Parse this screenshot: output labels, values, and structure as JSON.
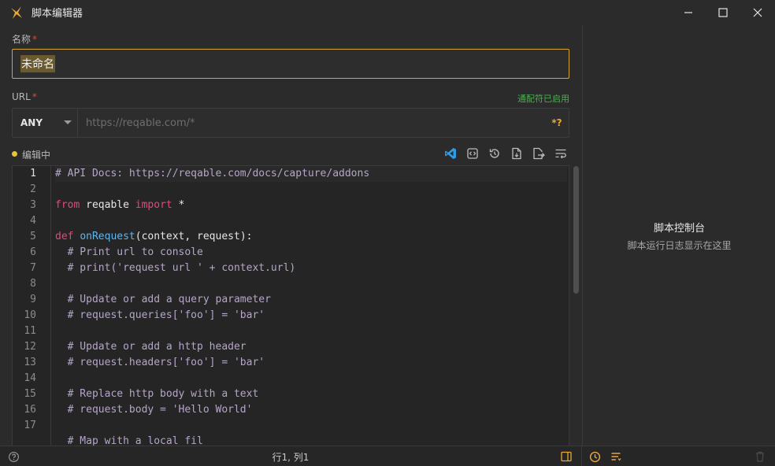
{
  "window": {
    "title": "脚本编辑器"
  },
  "form": {
    "name_label": "名称",
    "name_required": "*",
    "name_value": "未命名",
    "url_label": "URL",
    "url_required": "*",
    "wildcard_status": "通配符已启用",
    "method": "ANY",
    "url_placeholder": "https://reqable.com/*",
    "wildcard_button": "*?"
  },
  "editor": {
    "status": "编辑中",
    "status_color": "#e8c534",
    "line_numbers": [
      "1",
      "2",
      "3",
      "4",
      "5",
      "6",
      "7",
      "8",
      "9",
      "10",
      "11",
      "12",
      "13",
      "14",
      "15",
      "16",
      "17"
    ],
    "lines": [
      [
        {
          "t": "# API Docs: https://reqable.com/docs/capture/addons",
          "c": "cm"
        }
      ],
      [],
      [
        {
          "t": "from",
          "c": "kw"
        },
        {
          "t": " reqable ",
          "c": "pl"
        },
        {
          "t": "import",
          "c": "kw"
        },
        {
          "t": " *",
          "c": "pl"
        }
      ],
      [],
      [
        {
          "t": "def",
          "c": "kw"
        },
        {
          "t": " ",
          "c": "pl"
        },
        {
          "t": "onRequest",
          "c": "fn"
        },
        {
          "t": "(context, request):",
          "c": "pl"
        }
      ],
      [
        {
          "t": "  # Print url to console",
          "c": "cm"
        }
      ],
      [
        {
          "t": "  # print('request url ' + context.url)",
          "c": "cm"
        }
      ],
      [],
      [
        {
          "t": "  # Update or add a query parameter",
          "c": "cm"
        }
      ],
      [
        {
          "t": "  # request.queries['foo'] = 'bar'",
          "c": "cm"
        }
      ],
      [],
      [
        {
          "t": "  # Update or add a http header",
          "c": "cm"
        }
      ],
      [
        {
          "t": "  # request.headers['foo'] = 'bar'",
          "c": "cm"
        }
      ],
      [],
      [
        {
          "t": "  # Replace http body with a text",
          "c": "cm"
        }
      ],
      [
        {
          "t": "  # request.body = 'Hello World'",
          "c": "cm"
        }
      ],
      [],
      [
        {
          "t": "  # Map with a local fil",
          "c": "cm"
        }
      ]
    ]
  },
  "console": {
    "title": "脚本控制台",
    "subtitle": "脚本运行日志显示在这里"
  },
  "statusbar": {
    "cursor": "行1, 列1"
  },
  "colors": {
    "accent": "#d4a434",
    "success": "#4caf50",
    "required": "#e0453a",
    "keyword": "#e7477a",
    "function": "#5cb6f0",
    "comment": "#b6a5c9"
  },
  "icons": {
    "app": "app-logo-icon",
    "minimize": "minimize-icon",
    "maximize": "maximize-icon",
    "close": "close-icon",
    "vscode": "vscode-icon",
    "code": "code-snippet-icon",
    "history": "history-icon",
    "import": "file-import-icon",
    "export": "file-export-icon",
    "wrap": "word-wrap-icon",
    "help": "help-icon",
    "panel": "panel-toggle-icon",
    "clock": "clock-icon",
    "list": "list-icon",
    "trash": "trash-icon"
  }
}
